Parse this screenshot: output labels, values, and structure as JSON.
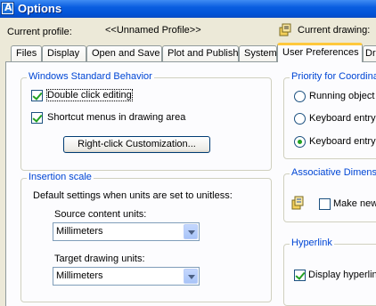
{
  "window": {
    "title": "Options"
  },
  "profile": {
    "label": "Current profile:",
    "value": "<<Unnamed Profile>>",
    "drawing_label": "Current drawing:"
  },
  "tabs": [
    {
      "label": "Files"
    },
    {
      "label": "Display"
    },
    {
      "label": "Open and Save"
    },
    {
      "label": "Plot and Publish"
    },
    {
      "label": "System"
    },
    {
      "label": "User Preferences",
      "active": true
    },
    {
      "label": "Dra"
    }
  ],
  "windows_behavior": {
    "title": "Windows Standard Behavior",
    "double_click": {
      "label": "Double click editing",
      "checked": true
    },
    "shortcut_menus": {
      "label": "Shortcut menus in drawing area",
      "checked": true
    },
    "right_click_button": "Right-click Customization..."
  },
  "insertion_scale": {
    "title": "Insertion scale",
    "description": "Default settings when units are set to unitless:",
    "source_label": "Source content units:",
    "source_value": "Millimeters",
    "target_label": "Target drawing units:",
    "target_value": "Millimeters"
  },
  "priority": {
    "title": "Priority for Coordinate",
    "options": [
      {
        "label": "Running object s",
        "selected": false
      },
      {
        "label": "Keyboard entry",
        "selected": false
      },
      {
        "label": "Keyboard entry e",
        "selected": true
      }
    ]
  },
  "associative": {
    "title": "Associative Dimensi",
    "make_new": {
      "label": "Make new",
      "checked": false
    }
  },
  "hyperlink": {
    "title": "Hyperlink",
    "display": {
      "label": "Display hyperlink",
      "checked": true
    }
  },
  "icons": {
    "app": "autocad-app-icon",
    "drawing": "drawing-icon",
    "associative": "associative-dimension-icon",
    "dropdown": "chevron-down-icon"
  },
  "colors": {
    "title_bar": "#0053d6",
    "group_title": "#0046d5",
    "active_tab_accent": "#ffc83c",
    "check": "#21a121"
  }
}
